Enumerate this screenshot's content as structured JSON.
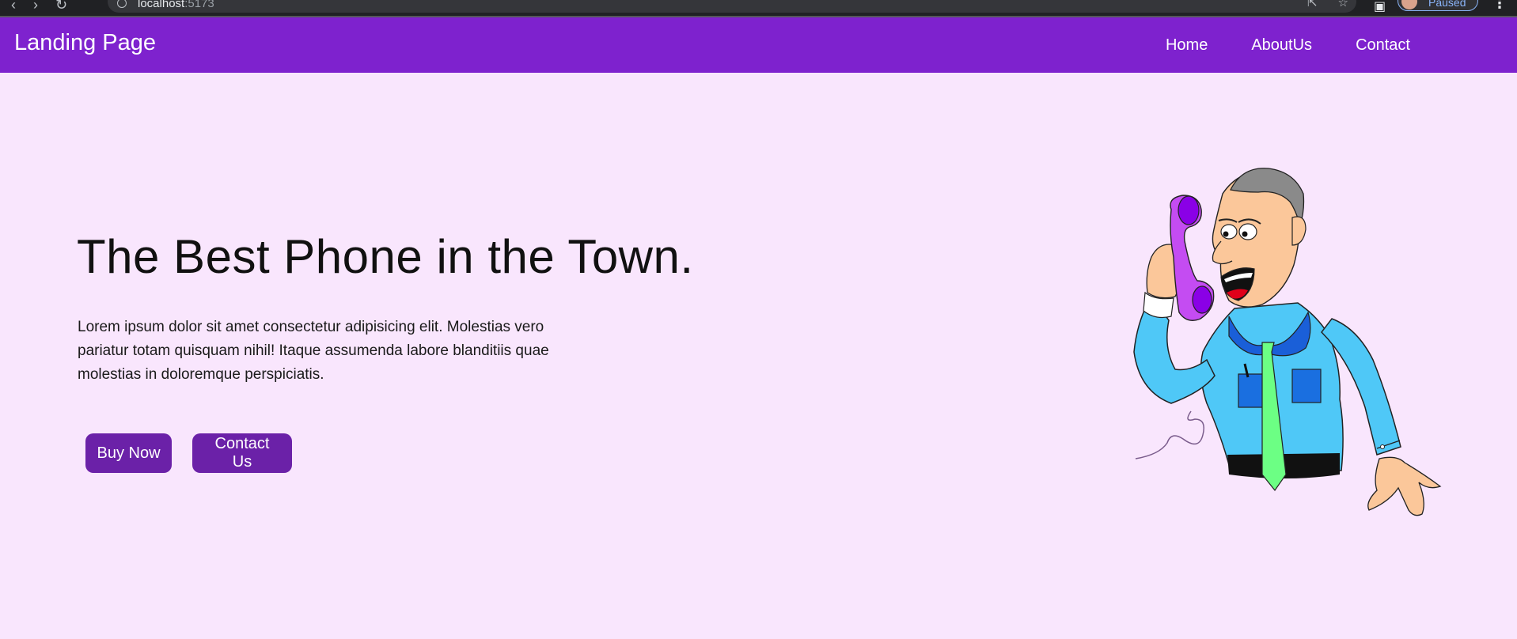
{
  "browser": {
    "url_host": "localhost",
    "url_port": ":5173",
    "profile_status": "Paused"
  },
  "navbar": {
    "brand": "Landing Page",
    "links": [
      "Home",
      "AboutUs",
      "Contact"
    ]
  },
  "hero": {
    "title": "The Best Phone in the Town.",
    "description": "Lorem ipsum dolor sit amet consectetur adipisicing elit. Molestias vero pariatur totam quisquam nihil! Itaque assumenda labore blanditiis quae molestias in doloremque perspiciatis.",
    "buttons": {
      "buy": "Buy Now",
      "contact": "Contact Us"
    },
    "illustration": "man-on-phone-illustration"
  },
  "colors": {
    "navbar": "#7e22ce",
    "button": "#6b21a8",
    "background": "#f9e6fd"
  }
}
